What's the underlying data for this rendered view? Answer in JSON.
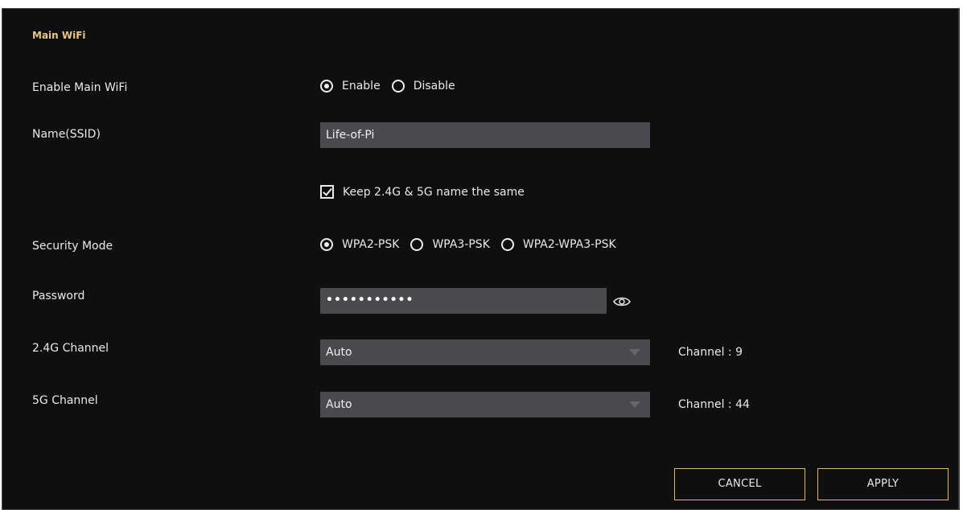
{
  "section_title": "Main WiFi",
  "enable_main_wifi": {
    "label": "Enable Main WiFi",
    "options": [
      "Enable",
      "Disable"
    ],
    "selected": "Enable"
  },
  "ssid": {
    "label": "Name(SSID)",
    "value": "Life-of-Pi"
  },
  "keep_same_name": {
    "label": "Keep 2.4G & 5G name the same",
    "checked": true
  },
  "security_mode": {
    "label": "Security Mode",
    "options": [
      "WPA2-PSK",
      "WPA3-PSK",
      "WPA2-WPA3-PSK"
    ],
    "selected": "WPA2-PSK"
  },
  "password": {
    "label": "Password",
    "masked_value": "•••••••••••",
    "icon": "eye-icon"
  },
  "channel_24g": {
    "label": "2.4G Channel",
    "selected": "Auto",
    "info": "Channel : 9"
  },
  "channel_5g": {
    "label": "5G Channel",
    "selected": "Auto",
    "info": "Channel : 44"
  },
  "buttons": {
    "cancel": "CANCEL",
    "apply": "APPLY"
  },
  "colors": {
    "background": "#0f0f0f",
    "field": "#4a4a4e",
    "accent": "#e0b766",
    "title": "#e8c87a",
    "text": "#e9e9e9"
  }
}
